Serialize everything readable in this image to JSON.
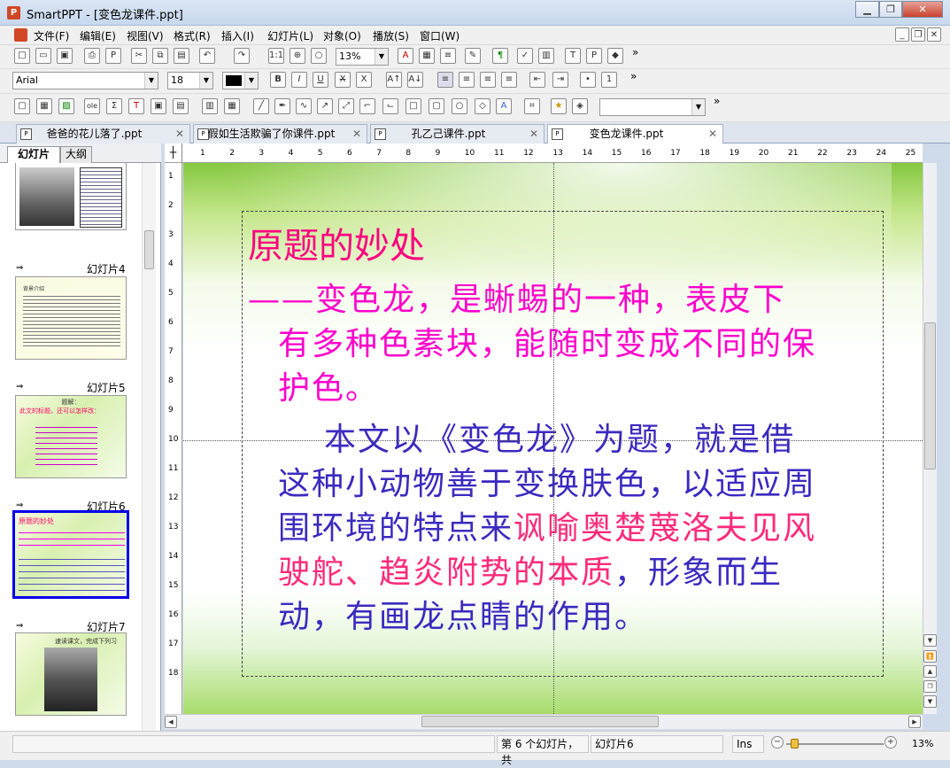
{
  "window": {
    "title": "SmartPPT - [变色龙课件.ppt]",
    "app_icon": "P"
  },
  "menu": [
    "文件(F)",
    "编辑(E)",
    "视图(V)",
    "格式(R)",
    "插入(I)",
    "幻灯片(L)",
    "对象(O)",
    "播放(S)",
    "窗口(W)"
  ],
  "toolbar": {
    "zoom": "13%",
    "font": "Arial",
    "size": "18",
    "more": "»"
  },
  "tabs": [
    "爸爸的花儿落了.ppt",
    "假如生活欺骗了你课件.ppt",
    "孔乙己课件.ppt",
    "变色龙课件.ppt"
  ],
  "pane_tabs": [
    "幻灯片",
    "大纲"
  ],
  "thumbnails": [
    {
      "label": "幻灯片4",
      "text": "背景介绍"
    },
    {
      "label": "幻灯片5",
      "title": "题解：",
      "subtitle": "此文的标题，还可以怎样改："
    },
    {
      "label": "幻灯片6",
      "title": "原题的妙处"
    },
    {
      "label": "幻灯片7",
      "title": "速读课文，完成下列习"
    }
  ],
  "slide": {
    "title": "原题的妙处",
    "lines": [
      {
        "text": "——变色龙，是蜥蜴的一种，表皮下",
        "color": "mag"
      },
      {
        "text": "有多种色素块，能随时变成不同的保",
        "color": "mag"
      },
      {
        "text": "护色。",
        "color": "mag"
      },
      {
        "text": "本文以《变色龙》为题，就是借",
        "color": "blu"
      },
      {
        "text": "这种小动物善于变换肤色，以适应周",
        "color": "blu"
      },
      {
        "part1": "围环境的特点来",
        "part2": "讽喻奥楚蔑洛夫见风"
      },
      {
        "part1": "驶舵、趋炎附势的本质",
        "part2": "，形象而生"
      },
      {
        "text": "动，有画龙点睛的作用。",
        "color": "blu"
      }
    ]
  },
  "status": {
    "slide_info": "第 6 个幻灯片，共",
    "slide_name": "幻灯片6",
    "mode": "Ins",
    "zoom": "13%"
  },
  "colors": {
    "title": "#ff0080",
    "magenta": "#ff00cc",
    "blue": "#3b2ac0",
    "red": "#ff2a7a",
    "selection": "#0000e8"
  }
}
